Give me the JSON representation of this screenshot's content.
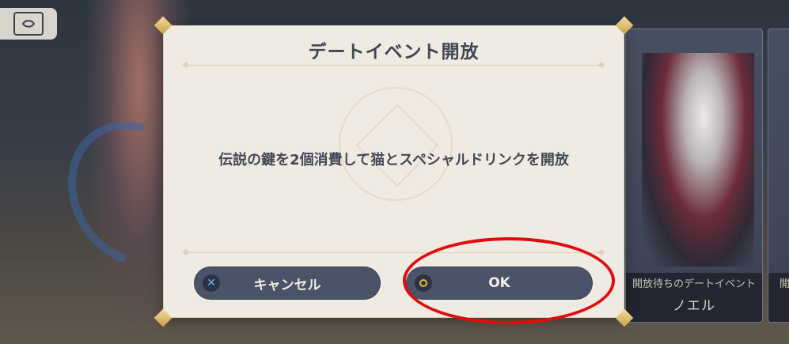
{
  "dialog": {
    "title": "デートイベント開放",
    "message": "伝説の鍵を2個消費して猫とスペシャルドリンクを開放",
    "cancel_label": "キャンセル",
    "ok_label": "OK"
  },
  "cards": [
    {
      "caption": "開放待ちのデートイベント",
      "name": "ノエル"
    },
    {
      "caption": "開",
      "name": ""
    }
  ],
  "icons": {
    "top_left": "dialogue-book-icon",
    "cancel": "x-button-icon",
    "ok": "circle-button-icon"
  },
  "colors": {
    "highlight": "#e00d0d",
    "button_bg": "#4a5367",
    "dialog_bg": "#efebe2",
    "x_icon": "#5fb3ff",
    "o_icon": "#f0b443"
  }
}
